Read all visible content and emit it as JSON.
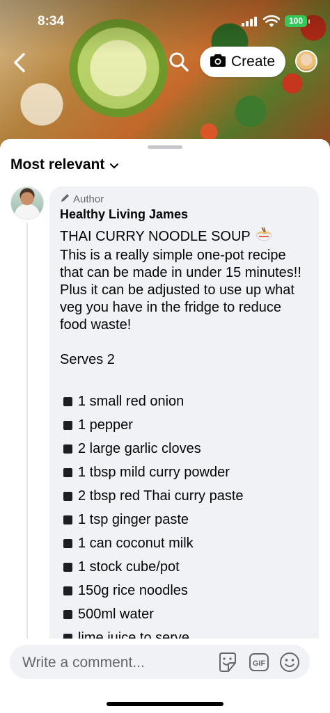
{
  "status_bar": {
    "time": "8:34",
    "battery": "100"
  },
  "header": {
    "back_icon": "chevron-left-icon",
    "search_icon": "search-icon",
    "create_label": "Create",
    "camera_icon": "camera-icon"
  },
  "comments": {
    "sort_label": "Most relevant",
    "items": [
      {
        "badge": "Author",
        "author": "Healthy Living James",
        "title": "THAI CURRY NOODLE SOUP",
        "title_emoji": "🍜",
        "intro": "This is a really simple one-pot recipe that can be made in under 15 minutes!! Plus it can be adjusted to use up what veg you have in the fridge to reduce food waste!",
        "serves": "Serves 2",
        "ingredients": [
          "1 small red onion",
          "1 pepper",
          "2 large garlic cloves",
          "1 tbsp mild curry powder",
          "2 tbsp red Thai curry paste",
          "1 tsp ginger paste",
          "1 can coconut milk",
          "1 stock cube/pot",
          "150g rice noodles",
          "500ml water",
          "lime juice to serve"
        ]
      }
    ]
  },
  "composer": {
    "placeholder": "Write a comment...",
    "sticker_icon": "sticker-icon",
    "gif_label": "GIF",
    "emoji_icon": "emoji-icon"
  },
  "colors": {
    "accent": "#050505",
    "bubble": "#f0f2f5",
    "secondary_text": "#65676b",
    "battery": "#35c759"
  }
}
